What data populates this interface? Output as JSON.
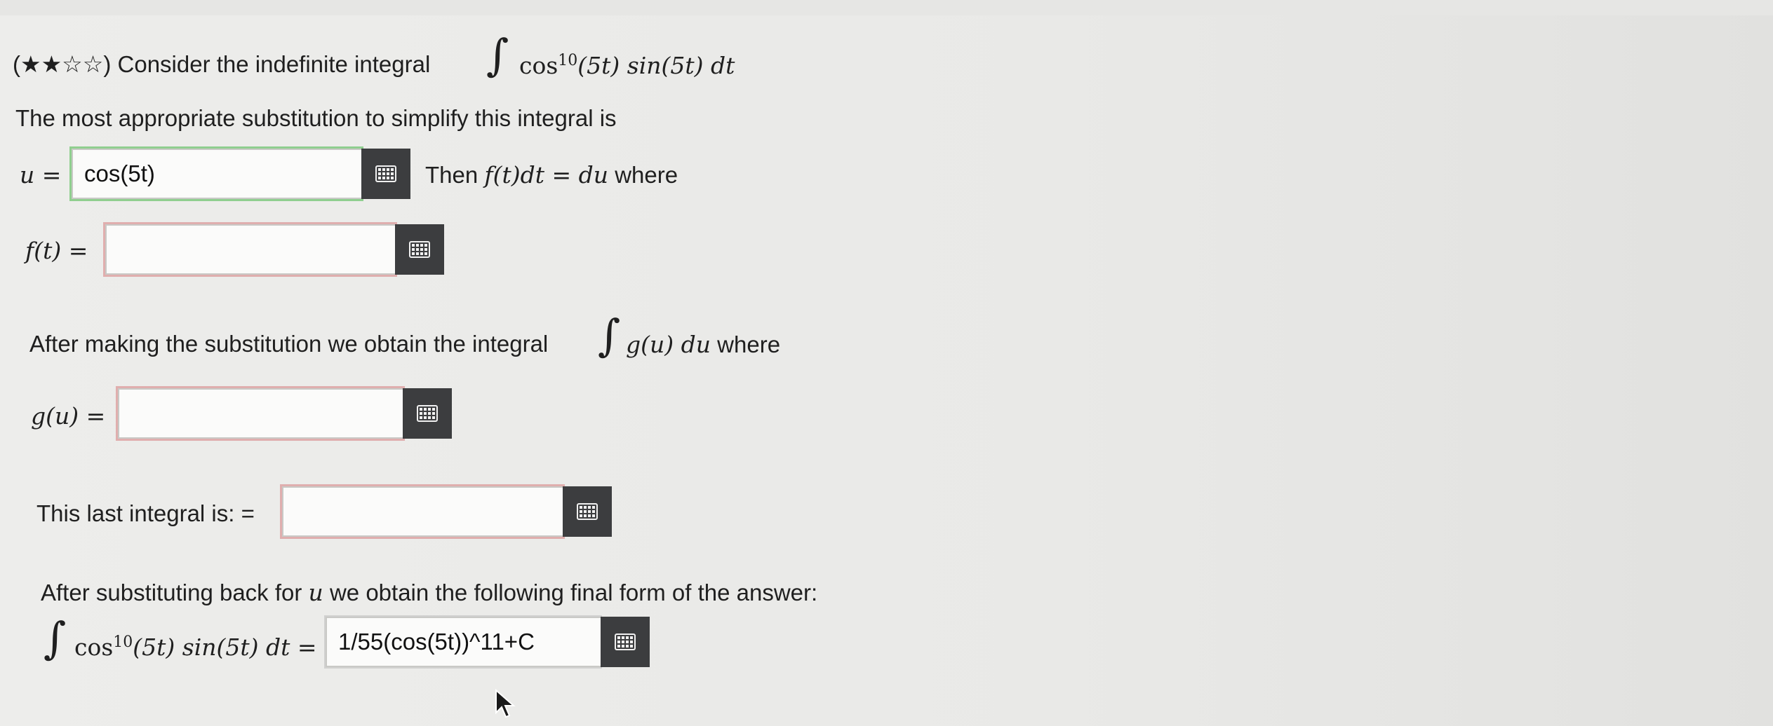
{
  "question": {
    "rating_prefix": "(",
    "rating_stars": "★★☆☆",
    "rating_suffix": ")",
    "intro": "Consider the indefinite integral",
    "integrand_cos": "cos",
    "integrand_exp": "10",
    "integrand_rest": "(5t) sin(5t) dt"
  },
  "substitution_line": "The most appropriate substitution to simplify this integral is",
  "u_field": {
    "label": "u =",
    "value": "cos(5t)",
    "after_text": "Then",
    "after_math": "f(t)dt = du",
    "after_tail": "where"
  },
  "f_field": {
    "label": "f(t) =",
    "value": ""
  },
  "after_sub": {
    "text": "After making the substitution we obtain the integral",
    "math": "g(u) du",
    "tail": "where"
  },
  "g_field": {
    "label": "g(u) =",
    "value": ""
  },
  "last_integral": {
    "label": "This last integral is: =",
    "value": ""
  },
  "final": {
    "text_before": "After substituting back for",
    "var": "u",
    "text_after": "we obtain the following final form of the answer:",
    "lhs_cos": "cos",
    "lhs_exp": "10",
    "lhs_rest": "(5t) sin(5t) dt =",
    "value": "1/55(cos(5t))^11+C"
  },
  "icons": {
    "keyboard": "keyboard-grid-icon",
    "integral": "integral-sign-icon",
    "cursor": "mouse-pointer-icon"
  }
}
